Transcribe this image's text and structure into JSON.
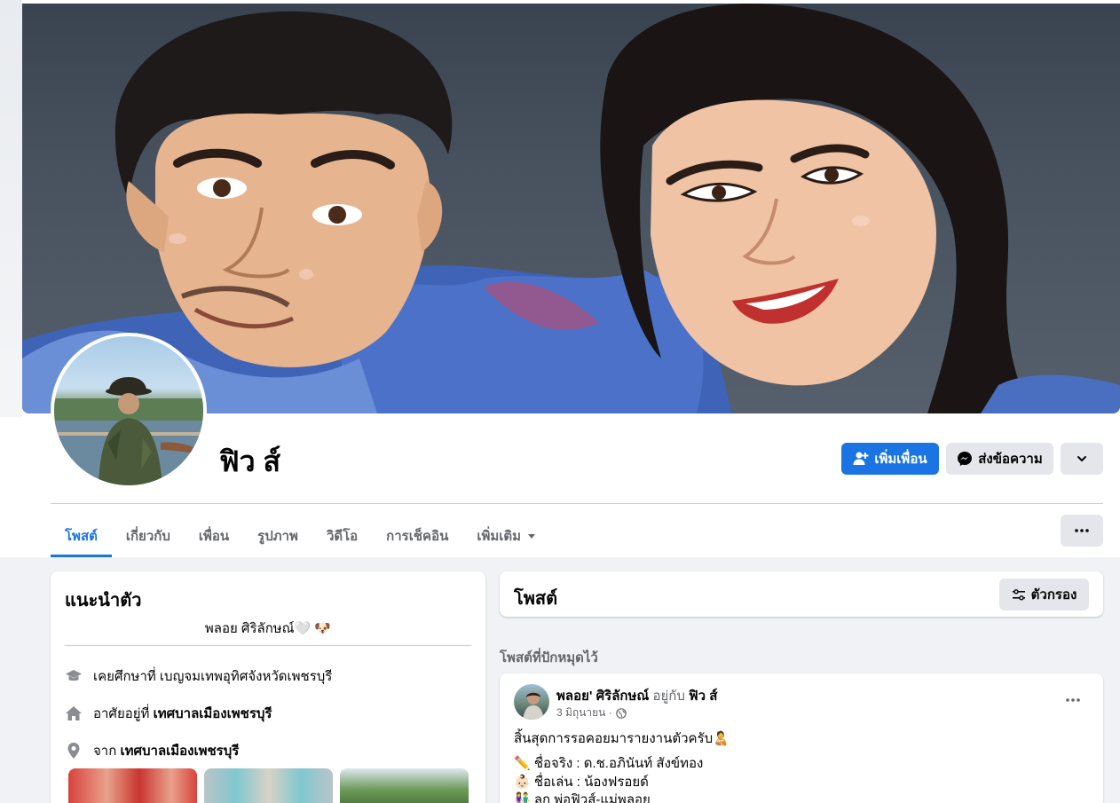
{
  "profile": {
    "name": "ฟิว ส์"
  },
  "actions": {
    "add_friend": "เพิ่มเพื่อน",
    "message": "ส่งข้อความ"
  },
  "tabs": [
    {
      "label": "โพสต์"
    },
    {
      "label": "เกี่ยวกับ"
    },
    {
      "label": "เพื่อน"
    },
    {
      "label": "รูปภาพ"
    },
    {
      "label": "วิดีโอ"
    },
    {
      "label": "การเช็คอิน"
    },
    {
      "label": "เพิ่มเติม"
    }
  ],
  "intro": {
    "title": "แนะนำตัว",
    "bio": "พลอย ศิริลักษณ์🤍 🐶",
    "education_prefix": "เคยศึกษาที่ เบญจมเทพอุทิศจังหวัดเพชรบุรี",
    "lives_prefix": "อาศัยอยู่ที่",
    "lives_place": "เทศบาลเมืองเพชรบุรี",
    "from_prefix": "จาก",
    "from_place": "เทศบาลเมืองเพชรบุรี"
  },
  "posts_header": {
    "title": "โพสต์",
    "filter": "ตัวกรอง"
  },
  "pinned_label": "โพสต์ที่ปักหมุดไว้",
  "post": {
    "author": "พลอย' ศิริลักษณ์",
    "with_word": "อยู่กับ",
    "with_name": "ฟิว ส์",
    "date": "3 มิถุนายน ·",
    "line1": "สิ้นสุดการรอคอยมารายงานตัวครับ🧑‍🍼",
    "line2": "✏️  ชื่อจริง : ด.ช.อภินันท์ สังข์ทอง",
    "line3": "👶🏻  ชื่อเล่น : น้องฟรอยด์",
    "line4": "👫 ลูก พ่อฟิวส์-แม่พลอย"
  },
  "colors": {
    "primary": "#1b74e4",
    "gray_button": "#e4e6eb",
    "page_bg": "#f0f2f5"
  }
}
